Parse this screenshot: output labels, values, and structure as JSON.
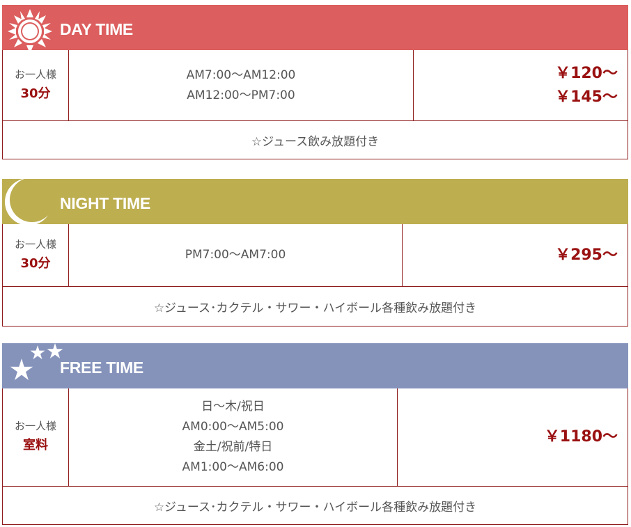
{
  "plans": [
    {
      "title": "DAY TIME",
      "icon": "sun-icon",
      "color": "#dc5e5e",
      "person_label": "お一人様",
      "unit": "30分",
      "times": [
        "AM7:00〜AM12:00",
        "AM12:00〜PM7:00"
      ],
      "prices": [
        "￥120〜",
        "￥145〜"
      ],
      "note": "☆ジュース飲み放題付き"
    },
    {
      "title": "NIGHT TIME",
      "icon": "crescent-moon-icon",
      "color": "#bdae50",
      "person_label": "お一人様",
      "unit": "30分",
      "times": [
        "PM7:00〜AM7:00"
      ],
      "prices": [
        "￥295〜"
      ],
      "note": "☆ジュース･カクテル・サワー・ハイボール各種飲み放題付き"
    },
    {
      "title": "FREE TIME",
      "icon": "stars-icon",
      "color": "#8593bb",
      "person_label": "お一人様",
      "unit": "室料",
      "times": [
        "日〜木/祝日",
        "AM0:00〜AM5:00",
        "金土/祝前/特日",
        "AM1:00〜AM6:00"
      ],
      "prices": [
        "￥1180〜"
      ],
      "note": "☆ジュース･カクテル・サワー・ハイボール各種飲み放題付き"
    }
  ]
}
